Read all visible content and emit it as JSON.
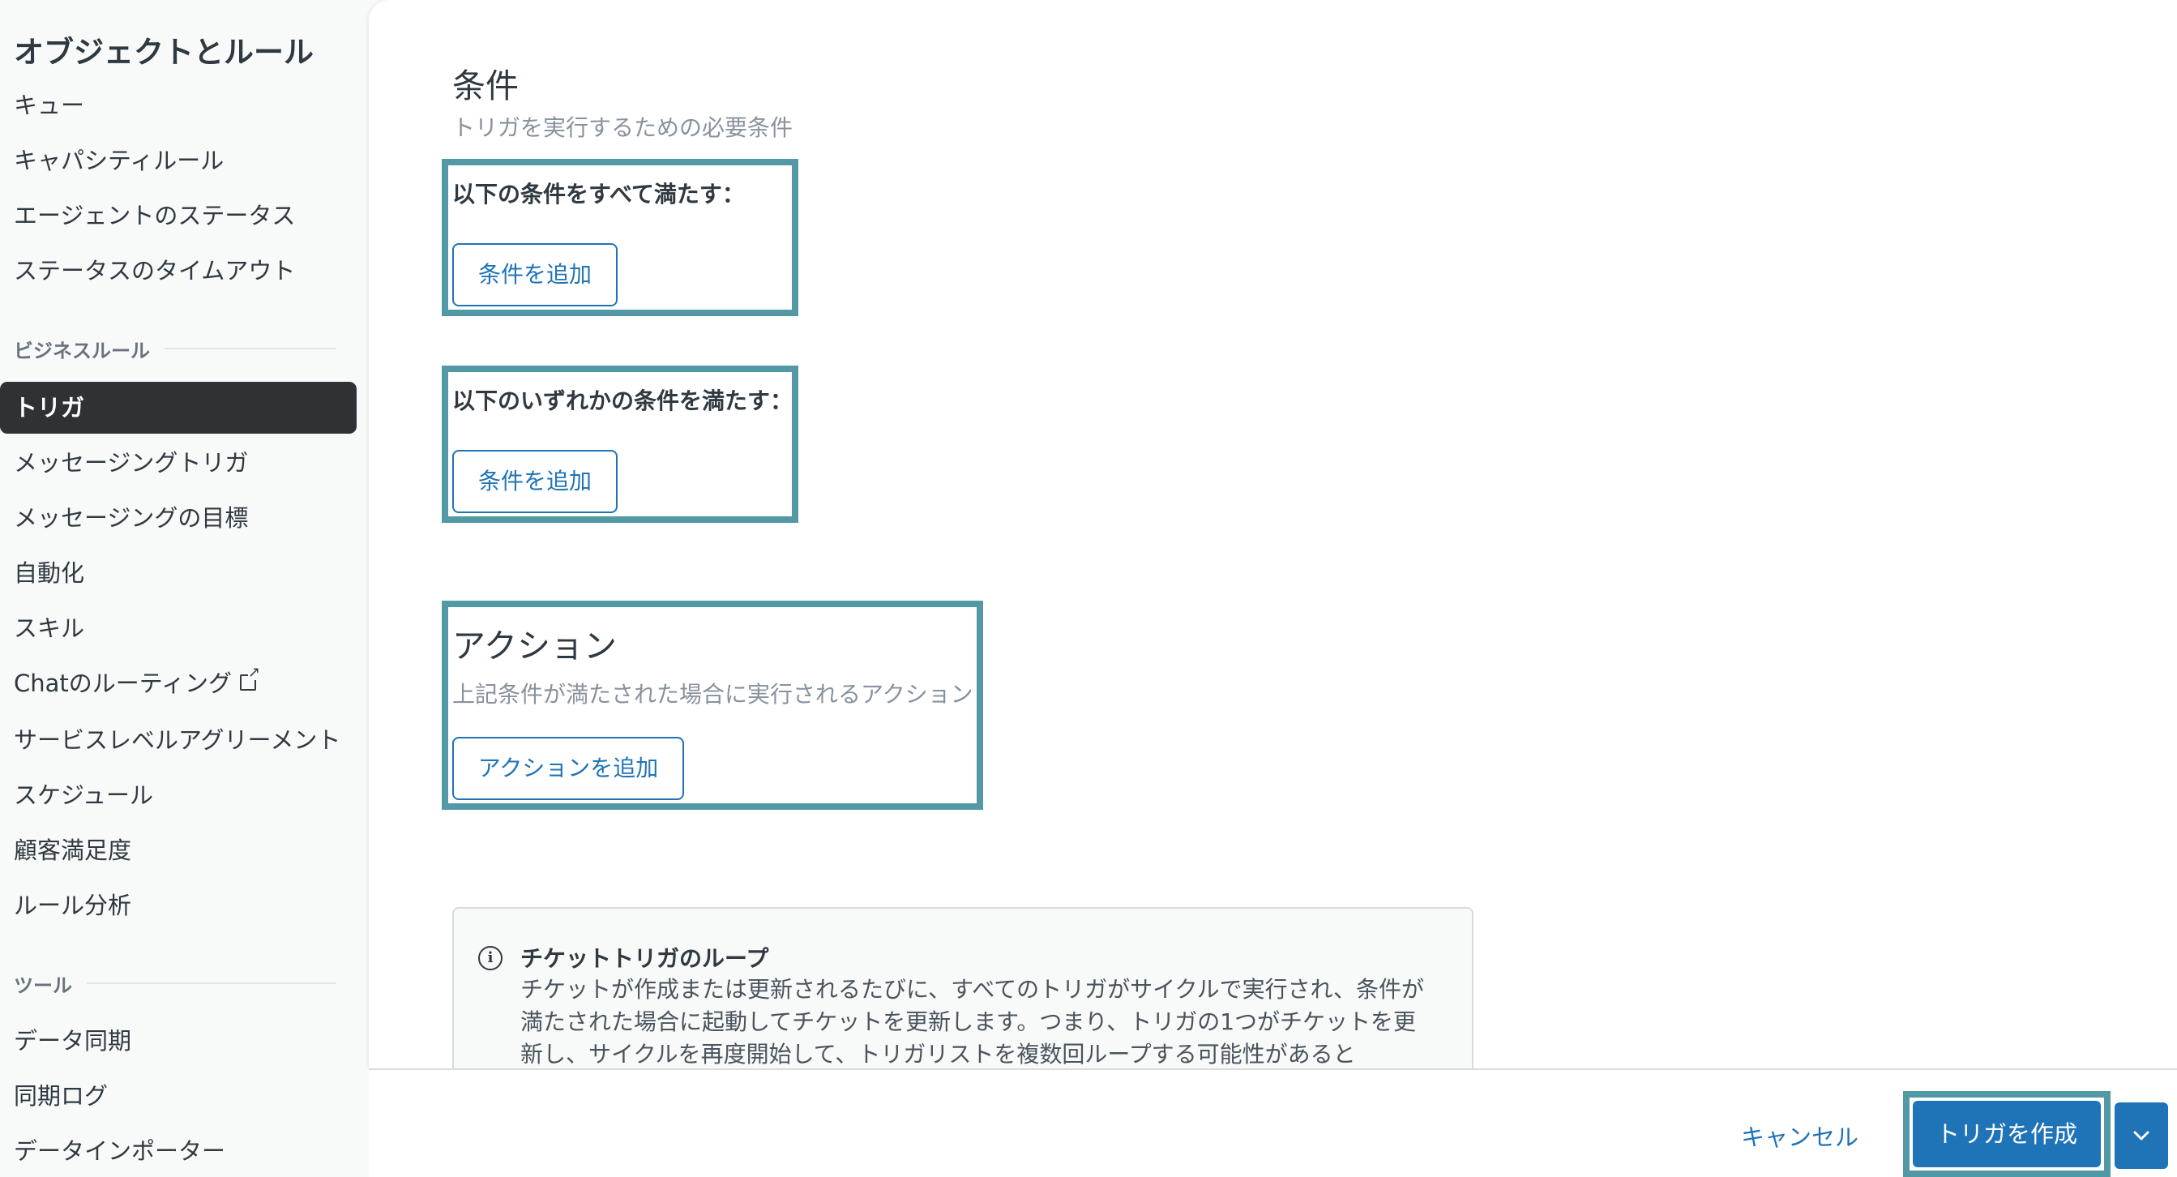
{
  "sidebar": {
    "title": "オブジェクトとルール",
    "items_top": [
      "キュー",
      "キャパシティルール",
      "エージェントのステータス",
      "ステータスのタイムアウト"
    ],
    "section_business": "ビジネスルール",
    "items_business": [
      "トリガ",
      "メッセージングトリガ",
      "メッセージングの目標",
      "自動化",
      "スキル",
      "Chatのルーティング",
      "サービスレベルアグリーメント",
      "スケジュール",
      "顧客満足度",
      "ルール分析"
    ],
    "active_item": "トリガ",
    "section_tools": "ツール",
    "items_tools": [
      "データ同期",
      "同期ログ",
      "データインポーター"
    ]
  },
  "conditions": {
    "heading": "条件",
    "description": "トリガを実行するための必要条件",
    "all_label": "以下の条件をすべて満たす：",
    "any_label": "以下のいずれかの条件を満たす：",
    "add_condition_label": "条件を追加"
  },
  "actions": {
    "heading": "アクション",
    "description": "上記条件が満たされた場合に実行されるアクション",
    "add_action_label": "アクションを追加"
  },
  "notice": {
    "title": "チケットトリガのループ",
    "body": "チケットが作成または更新されるたびに、すべてのトリガがサイクルで実行され、条件が満たされた場合に起動してチケットを更新します。つまり、トリガの1つがチケットを更新し、サイクルを再度開始して、トリガリストを複数回ループする可能性があると"
  },
  "footer": {
    "cancel_label": "キャンセル",
    "create_label": "トリガを作成"
  },
  "colors": {
    "primary": "#1f73b7",
    "highlight": "#5398a5",
    "active_nav": "#2f3134"
  }
}
